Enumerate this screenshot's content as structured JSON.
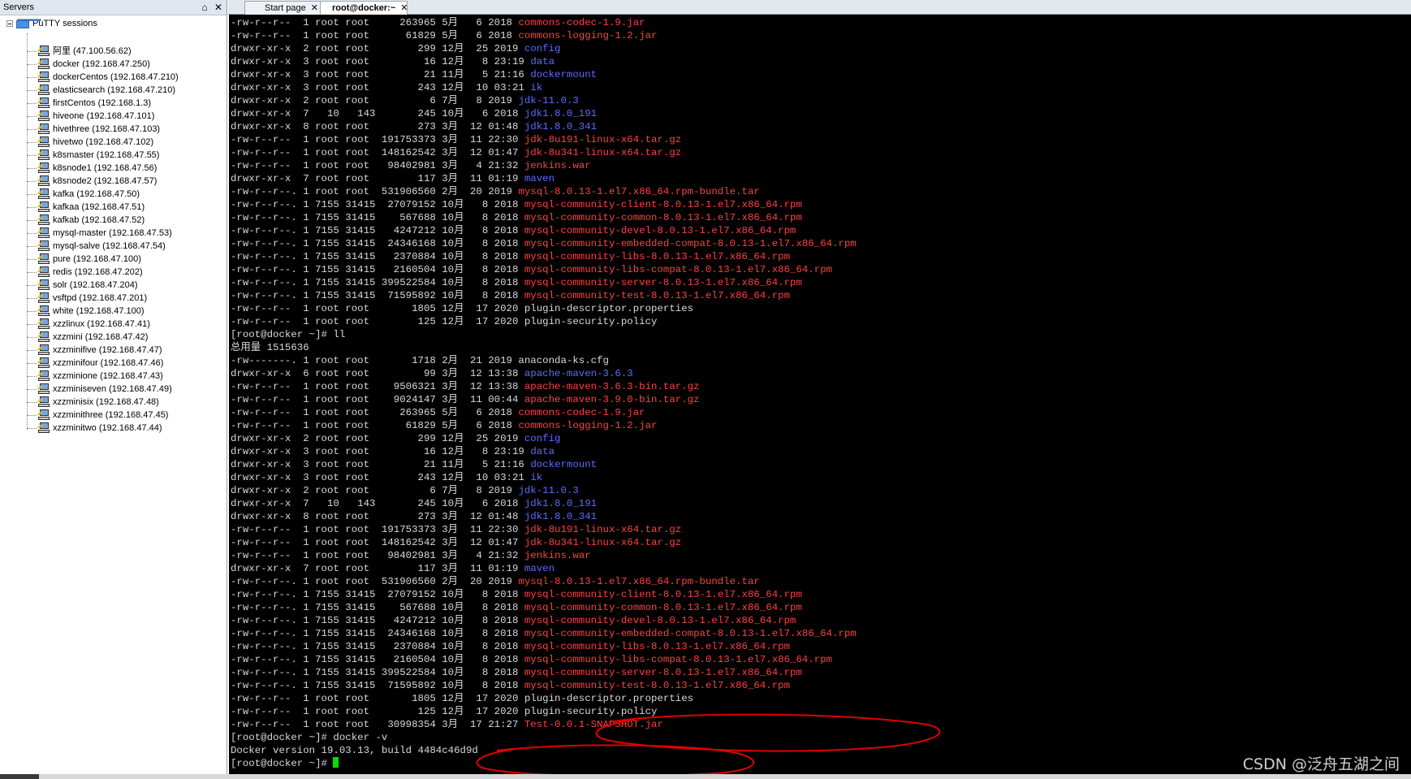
{
  "servers_panel": {
    "title": "Servers",
    "pin_glyph": "⌂",
    "close_glyph": "✕",
    "root_label": "PuTTY sessions",
    "sessions": [
      "阿里 (47.100.56.62)",
      "docker (192.168.47.250)",
      "dockerCentos (192.168.47.210)",
      "elasticsearch (192.168.47.210)",
      "firstCentos (192.168.1.3)",
      "hiveone (192.168.47.101)",
      "hivethree (192.168.47.103)",
      "hivetwo (192.168.47.102)",
      "k8smaster (192.168.47.55)",
      "k8snode1 (192.168.47.56)",
      "k8snode2 (192.168.47.57)",
      "kafka (192.168.47.50)",
      "kafkaa (192.168.47.51)",
      "kafkab (192.168.47.52)",
      "mysql-master (192.168.47.53)",
      "mysql-salve (192.168.47.54)",
      "pure (192.168.47.100)",
      "redis (192.168.47.202)",
      "solr (192.168.47.204)",
      "vsftpd (192.168.47.201)",
      "white (192.168.47.100)",
      "xzzlinux (192.168.47.41)",
      "xzzmini (192.168.47.42)",
      "xzzminifive (192.168.47.47)",
      "xzzminifour (192.168.47.46)",
      "xzzminione (192.168.47.43)",
      "xzzminiseven (192.168.47.49)",
      "xzzminisix (192.168.47.48)",
      "xzzminithree (192.168.47.45)",
      "xzzminitwo (192.168.47.44)"
    ]
  },
  "tabs": [
    {
      "label": "Start page",
      "close": "✕"
    },
    {
      "label": "root@docker:~",
      "close": "✕"
    }
  ],
  "terminal": {
    "lines": [
      [
        "-rw-r--r--  1 root root     263965 5月   6 2018 ",
        "commons-codec-1.9.jar",
        "red"
      ],
      [
        "-rw-r--r--  1 root root      61829 5月   6 2018 ",
        "commons-logging-1.2.jar",
        "red"
      ],
      [
        "drwxr-xr-x  2 root root        299 12月  25 2019 ",
        "config",
        "blue"
      ],
      [
        "drwxr-xr-x  3 root root         16 12月   8 23:19 ",
        "data",
        "blue"
      ],
      [
        "drwxr-xr-x  3 root root         21 11月   5 21:16 ",
        "dockermount",
        "blue"
      ],
      [
        "drwxr-xr-x  3 root root        243 12月  10 03:21 ",
        "ik",
        "blue"
      ],
      [
        "drwxr-xr-x  2 root root          6 7月   8 2019 ",
        "jdk-11.0.3",
        "blue"
      ],
      [
        "drwxr-xr-x  7   10   143       245 10月   6 2018 ",
        "jdk1.8.0_191",
        "blue"
      ],
      [
        "drwxr-xr-x  8 root root        273 3月  12 01:48 ",
        "jdk1.8.0_341",
        "blue"
      ],
      [
        "-rw-r--r--  1 root root  191753373 3月  11 22:30 ",
        "jdk-8u191-linux-x64.tar.gz",
        "red"
      ],
      [
        "-rw-r--r--  1 root root  148162542 3月  12 01:47 ",
        "jdk-8u341-linux-x64.tar.gz",
        "red"
      ],
      [
        "-rw-r--r--  1 root root   98402981 3月   4 21:32 ",
        "jenkins.war",
        "red"
      ],
      [
        "drwxr-xr-x  7 root root        117 3月  11 01:19 ",
        "maven",
        "blue"
      ],
      [
        "-rw-r--r--. 1 root root  531906560 2月  20 2019 ",
        "mysql-8.0.13-1.el7.x86_64.rpm-bundle.tar",
        "red"
      ],
      [
        "-rw-r--r--. 1 7155 31415  27079152 10月   8 2018 ",
        "mysql-community-client-8.0.13-1.el7.x86_64.rpm",
        "red"
      ],
      [
        "-rw-r--r--. 1 7155 31415    567688 10月   8 2018 ",
        "mysql-community-common-8.0.13-1.el7.x86_64.rpm",
        "red"
      ],
      [
        "-rw-r--r--. 1 7155 31415   4247212 10月   8 2018 ",
        "mysql-community-devel-8.0.13-1.el7.x86_64.rpm",
        "red"
      ],
      [
        "-rw-r--r--. 1 7155 31415  24346168 10月   8 2018 ",
        "mysql-community-embedded-compat-8.0.13-1.el7.x86_64.rpm",
        "red"
      ],
      [
        "-rw-r--r--. 1 7155 31415   2370884 10月   8 2018 ",
        "mysql-community-libs-8.0.13-1.el7.x86_64.rpm",
        "red"
      ],
      [
        "-rw-r--r--. 1 7155 31415   2160504 10月   8 2018 ",
        "mysql-community-libs-compat-8.0.13-1.el7.x86_64.rpm",
        "red"
      ],
      [
        "-rw-r--r--. 1 7155 31415 399522584 10月   8 2018 ",
        "mysql-community-server-8.0.13-1.el7.x86_64.rpm",
        "red"
      ],
      [
        "-rw-r--r--. 1 7155 31415  71595892 10月   8 2018 ",
        "mysql-community-test-8.0.13-1.el7.x86_64.rpm",
        "red"
      ],
      [
        "-rw-r--r--  1 root root       1805 12月  17 2020 plugin-descriptor.properties",
        "",
        ""
      ],
      [
        "-rw-r--r--  1 root root        125 12月  17 2020 plugin-security.policy",
        "",
        ""
      ],
      [
        "[root@docker ~]# ll",
        "",
        ""
      ],
      [
        "总用量 1515636",
        "",
        ""
      ],
      [
        "-rw-------. 1 root root       1718 2月  21 2019 anaconda-ks.cfg",
        "",
        ""
      ],
      [
        "drwxr-xr-x  6 root root         99 3月  12 13:38 ",
        "apache-maven-3.6.3",
        "blue"
      ],
      [
        "-rw-r--r--  1 root root    9506321 3月  12 13:38 ",
        "apache-maven-3.6.3-bin.tar.gz",
        "red"
      ],
      [
        "-rw-r--r--  1 root root    9024147 3月  11 00:44 ",
        "apache-maven-3.9.0-bin.tar.gz",
        "red"
      ],
      [
        "-rw-r--r--  1 root root     263965 5月   6 2018 ",
        "commons-codec-1.9.jar",
        "red"
      ],
      [
        "-rw-r--r--  1 root root      61829 5月   6 2018 ",
        "commons-logging-1.2.jar",
        "red"
      ],
      [
        "drwxr-xr-x  2 root root        299 12月  25 2019 ",
        "config",
        "blue"
      ],
      [
        "drwxr-xr-x  3 root root         16 12月   8 23:19 ",
        "data",
        "blue"
      ],
      [
        "drwxr-xr-x  3 root root         21 11月   5 21:16 ",
        "dockermount",
        "blue"
      ],
      [
        "drwxr-xr-x  3 root root        243 12月  10 03:21 ",
        "ik",
        "blue"
      ],
      [
        "drwxr-xr-x  2 root root          6 7月   8 2019 ",
        "jdk-11.0.3",
        "blue"
      ],
      [
        "drwxr-xr-x  7   10   143       245 10月   6 2018 ",
        "jdk1.8.0_191",
        "blue"
      ],
      [
        "drwxr-xr-x  8 root root        273 3月  12 01:48 ",
        "jdk1.8.0_341",
        "blue"
      ],
      [
        "-rw-r--r--  1 root root  191753373 3月  11 22:30 ",
        "jdk-8u191-linux-x64.tar.gz",
        "red"
      ],
      [
        "-rw-r--r--  1 root root  148162542 3月  12 01:47 ",
        "jdk-8u341-linux-x64.tar.gz",
        "red"
      ],
      [
        "-rw-r--r--  1 root root   98402981 3月   4 21:32 ",
        "jenkins.war",
        "red"
      ],
      [
        "drwxr-xr-x  7 root root        117 3月  11 01:19 ",
        "maven",
        "blue"
      ],
      [
        "-rw-r--r--. 1 root root  531906560 2月  20 2019 ",
        "mysql-8.0.13-1.el7.x86_64.rpm-bundle.tar",
        "red"
      ],
      [
        "-rw-r--r--. 1 7155 31415  27079152 10月   8 2018 ",
        "mysql-community-client-8.0.13-1.el7.x86_64.rpm",
        "red"
      ],
      [
        "-rw-r--r--. 1 7155 31415    567688 10月   8 2018 ",
        "mysql-community-common-8.0.13-1.el7.x86_64.rpm",
        "red"
      ],
      [
        "-rw-r--r--. 1 7155 31415   4247212 10月   8 2018 ",
        "mysql-community-devel-8.0.13-1.el7.x86_64.rpm",
        "red"
      ],
      [
        "-rw-r--r--. 1 7155 31415  24346168 10月   8 2018 ",
        "mysql-community-embedded-compat-8.0.13-1.el7.x86_64.rpm",
        "red"
      ],
      [
        "-rw-r--r--. 1 7155 31415   2370884 10月   8 2018 ",
        "mysql-community-libs-8.0.13-1.el7.x86_64.rpm",
        "red"
      ],
      [
        "-rw-r--r--. 1 7155 31415   2160504 10月   8 2018 ",
        "mysql-community-libs-compat-8.0.13-1.el7.x86_64.rpm",
        "red"
      ],
      [
        "-rw-r--r--. 1 7155 31415 399522584 10月   8 2018 ",
        "mysql-community-server-8.0.13-1.el7.x86_64.rpm",
        "red"
      ],
      [
        "-rw-r--r--. 1 7155 31415  71595892 10月   8 2018 ",
        "mysql-community-test-8.0.13-1.el7.x86_64.rpm",
        "red"
      ],
      [
        "-rw-r--r--  1 root root       1805 12月  17 2020 plugin-descriptor.properties",
        "",
        ""
      ],
      [
        "-rw-r--r--  1 root root        125 12月  17 2020 plugin-security.policy",
        "",
        ""
      ],
      [
        "-rw-r--r--  1 root root   30998354 3月  17 21:27 ",
        "Test-0.0.1-SNAPSHOT.jar",
        "red"
      ],
      [
        "[root@docker ~]# docker -v",
        "",
        ""
      ],
      [
        "Docker version 19.03.13, build 4484c46d9d",
        "",
        ""
      ],
      [
        "[root@docker ~]# ",
        "",
        "cursor"
      ]
    ]
  },
  "watermark": "CSDN @泛舟五湖之间",
  "colors": {
    "terminal_bg": "#000000",
    "terminal_fg": "#d9d9d9",
    "dir_blue": "#5c6cff",
    "archive_red": "#ff4040",
    "cursor_green": "#00e000",
    "annotation_red": "#e00000"
  }
}
